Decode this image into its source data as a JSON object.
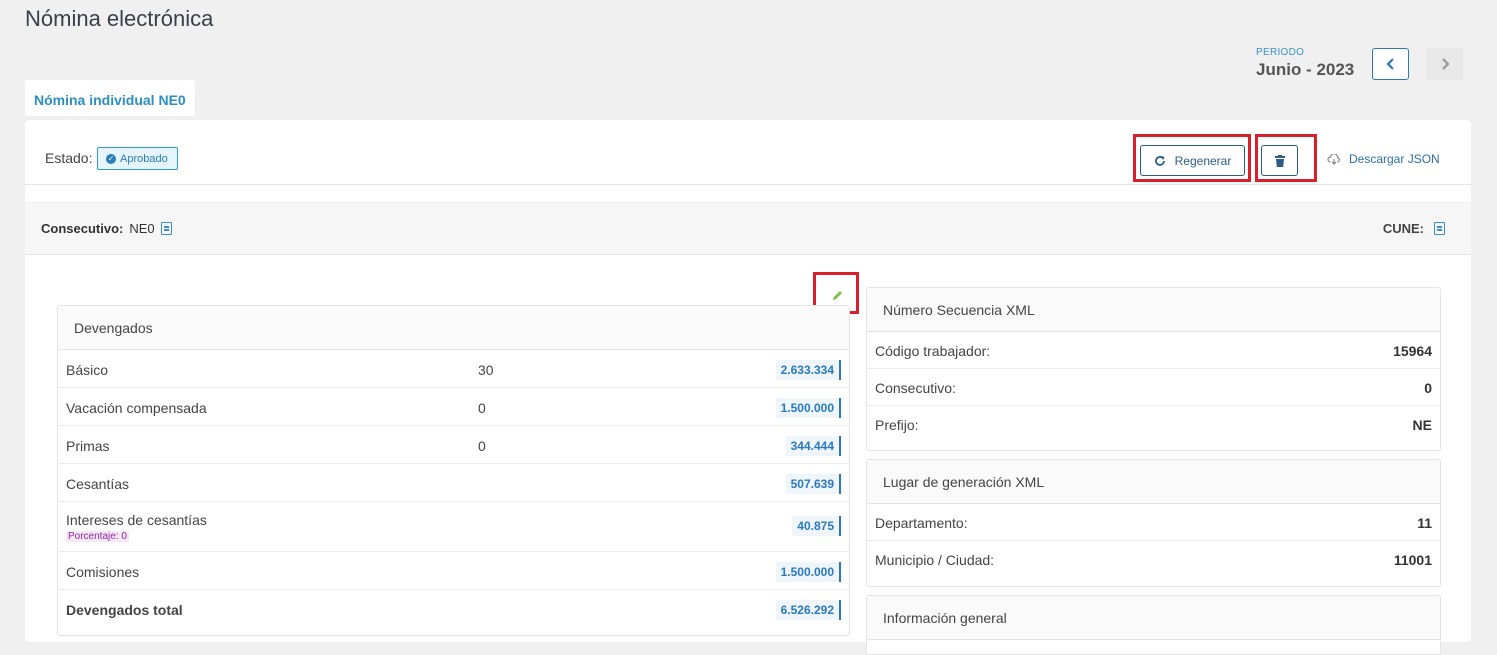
{
  "page": {
    "title": "Nómina electrónica"
  },
  "periodo": {
    "label": "PERIODO",
    "value": "Junio - 2023"
  },
  "tabs": [
    {
      "label": "Nómina individual NE0"
    }
  ],
  "estado": {
    "label": "Estado:",
    "badge": "Aprobado"
  },
  "toolbar": {
    "regenerar_label": "Regenerar",
    "descargar_label": "Descargar JSON"
  },
  "consecutivo": {
    "label": "Consecutivo:",
    "value": "NE0",
    "cune_label": "CUNE:"
  },
  "devengados": {
    "title": "Devengados",
    "rows": [
      {
        "label": "Básico",
        "qty": "30",
        "value": "2.633.334"
      },
      {
        "label": "Vacación compensada",
        "qty": "0",
        "value": "1.500.000"
      },
      {
        "label": "Primas",
        "qty": "0",
        "value": "344.444"
      },
      {
        "label": "Cesantías",
        "qty": "",
        "value": "507.639"
      },
      {
        "label": "Intereses de cesantías",
        "qty": "",
        "value": "40.875",
        "note": "Porcentaje: 0"
      },
      {
        "label": "Comisiones",
        "qty": "",
        "value": "1.500.000"
      },
      {
        "label": "Devengados total",
        "qty": "",
        "value": "6.526.292"
      }
    ]
  },
  "secuencia": {
    "title": "Número Secuencia XML",
    "rows": [
      {
        "label": "Código trabajador:",
        "value": "15964"
      },
      {
        "label": "Consecutivo:",
        "value": "0"
      },
      {
        "label": "Prefijo:",
        "value": "NE"
      }
    ]
  },
  "lugar": {
    "title": "Lugar de generación XML",
    "rows": [
      {
        "label": "Departamento:",
        "value": "11"
      },
      {
        "label": "Municipio / Ciudad:",
        "value": "11001"
      }
    ]
  },
  "general": {
    "title": "Información general"
  },
  "colors": {
    "accent": "#2a78c2",
    "highlight": "#d9202a",
    "badge": "#2b9bd2"
  },
  "icons": [
    "chevron-left-icon",
    "chevron-right-icon",
    "check-circle-icon",
    "refresh-icon",
    "trash-icon",
    "cloud-download-icon",
    "document-icon",
    "pencil-icon"
  ]
}
